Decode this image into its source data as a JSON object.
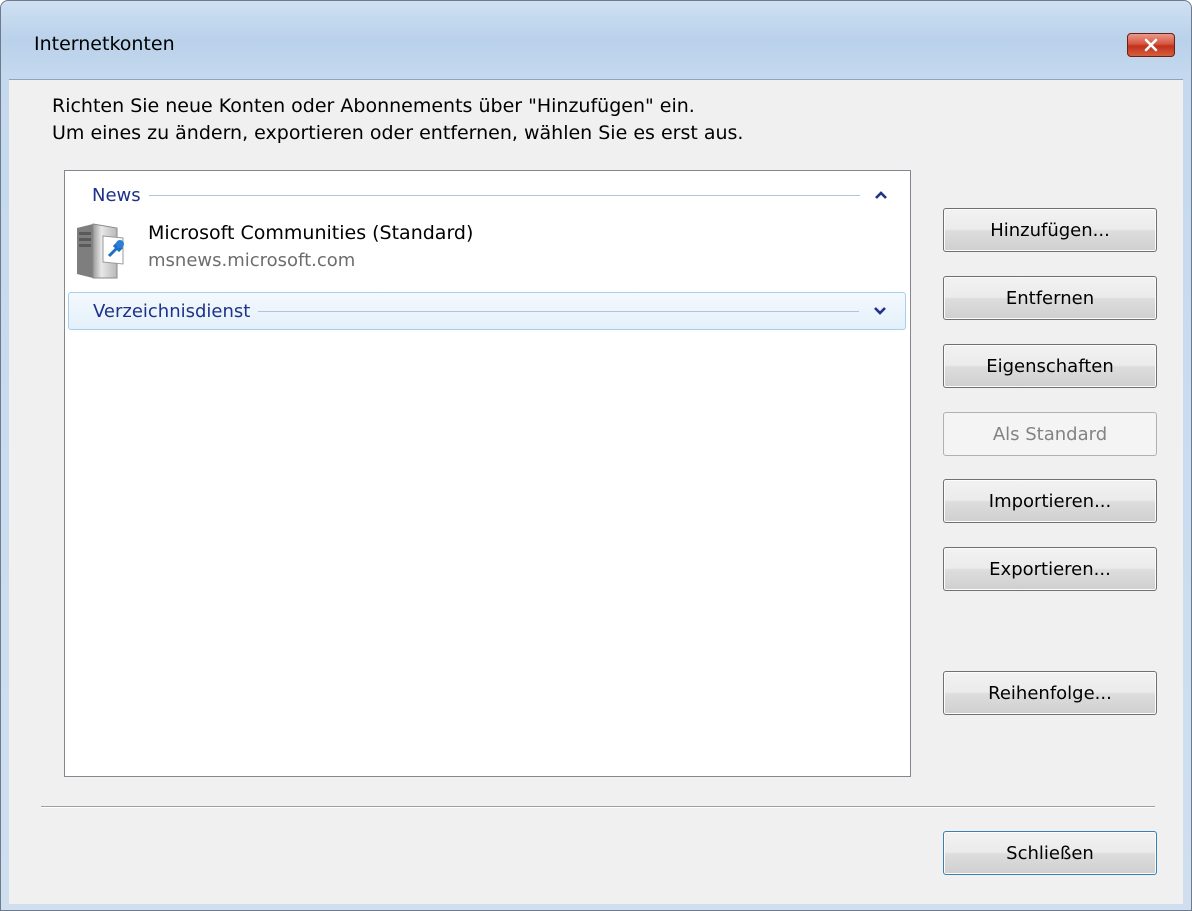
{
  "window": {
    "title": "Internetkonten"
  },
  "intro": {
    "line1": "Richten Sie neue Konten oder Abonnements über \"Hinzufügen\" ein.",
    "line2": "Um eines zu ändern, exportieren oder entfernen, wählen Sie es erst aus."
  },
  "list": {
    "groups": [
      {
        "label": "News",
        "expanded": true,
        "chevron": "chevron-up-icon",
        "items": [
          {
            "name": "Microsoft Communities (Standard)",
            "host": "msnews.microsoft.com",
            "icon": "news-server-icon"
          }
        ]
      },
      {
        "label": "Verzeichnisdienst",
        "expanded": false,
        "selected": true,
        "chevron": "chevron-down-icon",
        "items": []
      }
    ]
  },
  "buttons": {
    "add": "Hinzufügen...",
    "remove": "Entfernen",
    "properties": "Eigenschaften",
    "set_default": "Als Standard",
    "import": "Importieren...",
    "export": "Exportieren...",
    "order": "Reihenfolge...",
    "close": "Schließen"
  },
  "colors": {
    "group_header_text": "#1e3287",
    "close_button": "#c0311b",
    "selection_border": "#a6d0ee"
  }
}
